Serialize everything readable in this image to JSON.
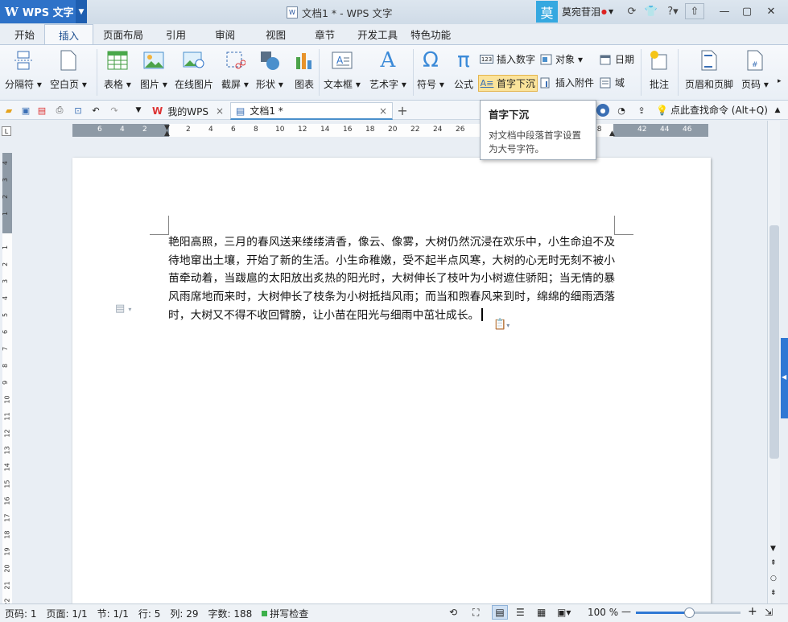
{
  "app": {
    "name": "WPS 文字",
    "logo": "W"
  },
  "window": {
    "title": "文档1 * - WPS 文字"
  },
  "user": {
    "avatar_char": "莫",
    "name": "莫宛苷泪"
  },
  "tabs": [
    "开始",
    "插入",
    "页面布局",
    "引用",
    "审阅",
    "视图",
    "章节",
    "开发工具",
    "特色功能"
  ],
  "active_tab": "插入",
  "ribbon": {
    "section_break": "分隔符",
    "blank_page": "空白页",
    "table": "表格",
    "picture": "图片",
    "online_picture": "在线图片",
    "screenshot": "截屏",
    "shape": "形状",
    "chart": "图表",
    "textbox": "文本框",
    "wordart": "艺术字",
    "symbol": "符号",
    "formula": "公式",
    "insert_number": "插入数字",
    "object": "对象",
    "date": "日期",
    "dropcap": "首字下沉",
    "attachment": "插入附件",
    "field": "域",
    "comment": "批注",
    "header_footer": "页眉和页脚",
    "page_number": "页码"
  },
  "doc_tabs": {
    "home": "我的WPS",
    "doc": "文档1 *",
    "close": "×",
    "add": "+"
  },
  "search_command": "点此查找命令 (Alt+Q)",
  "tooltip": {
    "title": "首字下沉",
    "desc": "对文档中段落首字设置为大号字符。"
  },
  "ruler_ticks_left": [
    "6",
    "4",
    "2"
  ],
  "ruler_ticks_main": [
    "2",
    "4",
    "6",
    "8",
    "10",
    "12",
    "14",
    "16",
    "18",
    "20",
    "22",
    "24",
    "26"
  ],
  "ruler_ticks_right": [
    "38",
    "42",
    "44",
    "46"
  ],
  "document": {
    "body": "艳阳高照，三月的春风送来缕缕清香，像云、像雾，大树仍然沉浸在欢乐中，小生命迫不及待地窜出土壤，开始了新的生活。小生命稚嫩，受不起半点风寒，大树的心无时无刻不被小苗牵动着，当跋扈的太阳放出炙热的阳光时，大树伸长了枝叶为小树遮住骄阳；当无情的暴风雨席地而来时，大树伸长了枝条为小树抵挡风雨；而当和煦春风来到时，绵绵的细雨洒落时，大树又不得不收回臂膀，让小苗在阳光与细雨中茁壮成长。"
  },
  "status": {
    "page_code": "页码: 1",
    "page": "页面: 1/1",
    "section": "节: 1/1",
    "row": "行: 5",
    "col": "列: 29",
    "words": "字数: 188",
    "spell": "拼写检查",
    "zoom": "100 %"
  },
  "colors": {
    "accent": "#2e72c8",
    "zoom_bar": "#2f78d4"
  }
}
